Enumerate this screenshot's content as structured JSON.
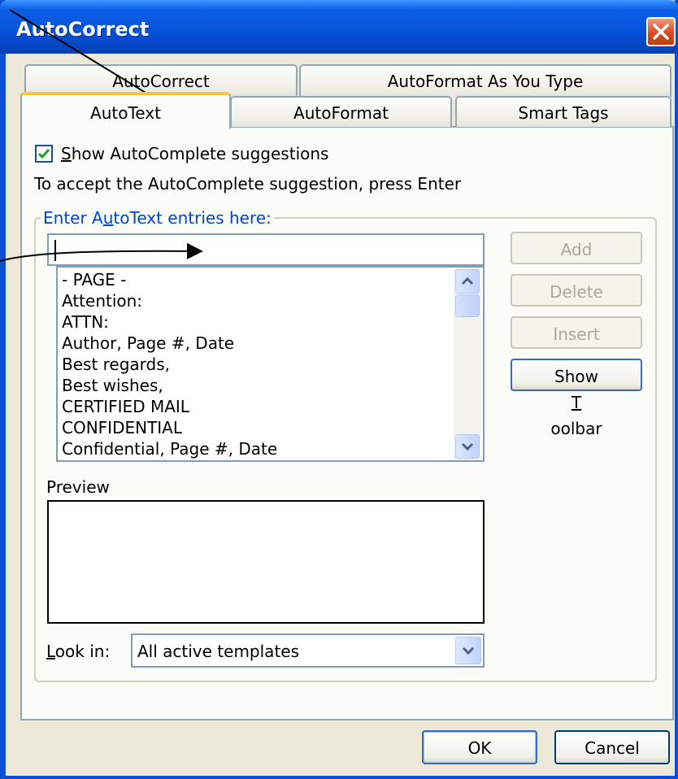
{
  "window": {
    "title": "AutoCorrect"
  },
  "tabs_back": [
    {
      "label": "AutoCorrect"
    },
    {
      "label": "AutoFormat As You Type"
    }
  ],
  "tabs_front": [
    {
      "label": "AutoText",
      "active": true
    },
    {
      "label": "AutoFormat"
    },
    {
      "label": "Smart Tags"
    }
  ],
  "autotext": {
    "show_suggestions": {
      "label_u": "S",
      "label_rest": "how AutoComplete suggestions",
      "checked": true
    },
    "hint": "To accept the AutoComplete suggestion, press Enter",
    "group": {
      "label_pre": "Enter A",
      "label_u": "u",
      "label_post": "toText entries here:"
    },
    "entry_value": "",
    "entries": [
      "- PAGE -",
      "Attention:",
      "ATTN:",
      "Author, Page #, Date",
      "Best regards,",
      "Best wishes,",
      "CERTIFIED MAIL",
      "CONFIDENTIAL",
      "Confidential, Page #, Date"
    ],
    "buttons": {
      "add": "Add",
      "delete": "Delete",
      "insert": "Insert",
      "show_toolbar_pre": "Show ",
      "show_toolbar_u": "T",
      "show_toolbar_post": "oolbar"
    },
    "preview_label": "Preview",
    "look_in": {
      "label_u": "L",
      "label_rest": "ook in:",
      "value": "All active templates"
    }
  },
  "footer": {
    "ok": "OK",
    "cancel": "Cancel"
  },
  "colors": {
    "title_bar": "#0753db",
    "group_label": "#0046d5",
    "active_tab_accent": "#ffc83c"
  }
}
